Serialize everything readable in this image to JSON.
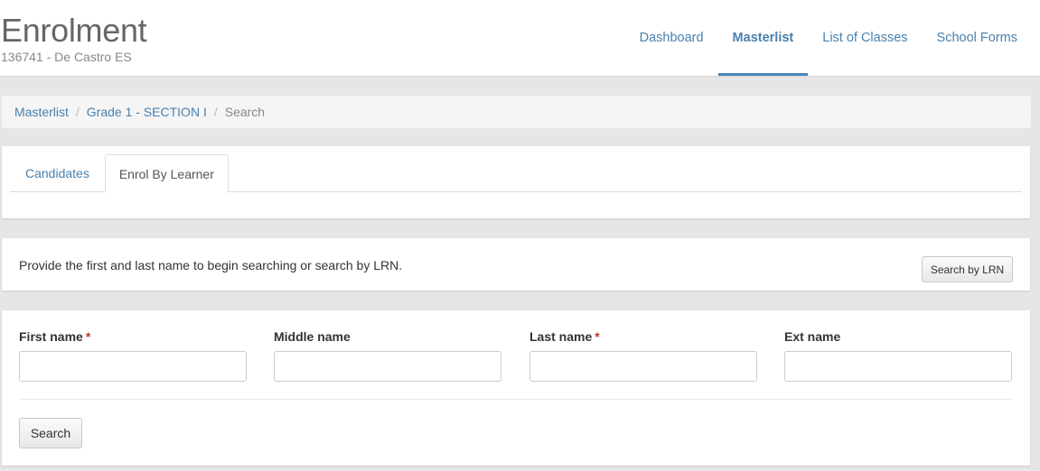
{
  "header": {
    "title": "Enrolment",
    "subtitle": "136741 - De Castro ES",
    "nav": [
      {
        "label": "Dashboard",
        "active": false
      },
      {
        "label": "Masterlist",
        "active": true
      },
      {
        "label": "List of Classes",
        "active": false
      },
      {
        "label": "School Forms",
        "active": false
      }
    ]
  },
  "breadcrumb": {
    "items": [
      "Masterlist",
      "Grade 1 - SECTION I"
    ],
    "current": "Search",
    "separator": "/"
  },
  "tabs": [
    {
      "label": "Candidates",
      "active": false
    },
    {
      "label": "Enrol By Learner",
      "active": true
    }
  ],
  "info": {
    "text": "Provide the first and last name to begin searching or search by LRN.",
    "lrn_button": "Search by LRN"
  },
  "form": {
    "fields": [
      {
        "label": "First name",
        "required": true,
        "value": "",
        "placeholder": ""
      },
      {
        "label": "Middle name",
        "required": false,
        "value": "",
        "placeholder": ""
      },
      {
        "label": "Last name",
        "required": true,
        "value": "",
        "placeholder": ""
      },
      {
        "label": "Ext name",
        "required": false,
        "value": "",
        "placeholder": ""
      }
    ],
    "required_mark": "*",
    "search_button": "Search"
  },
  "colors": {
    "accent": "#4a80ad",
    "required": "#c0392b",
    "background": "#e6e6e6"
  }
}
